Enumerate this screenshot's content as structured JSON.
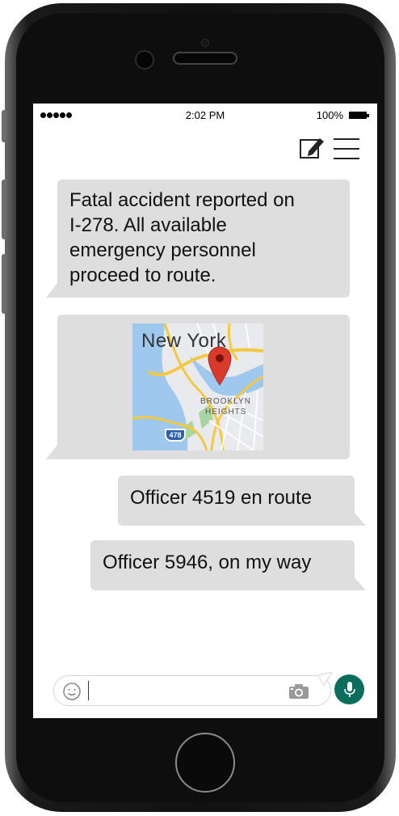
{
  "status_bar": {
    "time": "2:02 PM",
    "battery": "100%"
  },
  "toolbar": {
    "compose_icon": "compose-icon",
    "menu_icon": "hamburger-menu-icon"
  },
  "messages": [
    {
      "direction": "incoming",
      "text": "Fatal accident reported on I-278. All available emergency personnel proceed to route.",
      "lines": [
        "Fatal accident reported on",
        "I-278. All available",
        "emergency personnel",
        "proceed to route."
      ]
    },
    {
      "direction": "incoming",
      "type": "map",
      "map": {
        "city_label": "New York",
        "area_label_line1": "BROOKLYN",
        "area_label_line2": "HEIGHTS",
        "route_shield": "478",
        "pin_icon": "map-pin-icon"
      }
    },
    {
      "direction": "outgoing",
      "text": "Officer 4519 en route"
    },
    {
      "direction": "outgoing",
      "text": "Officer 5946, on my way"
    }
  ],
  "input_bar": {
    "value": "",
    "emoji_icon": "emoji-icon",
    "camera_icon": "camera-icon",
    "mic_icon": "microphone-icon"
  },
  "colors": {
    "bubble": "#dedede",
    "mic_button": "#0b6e5c",
    "map_water": "#9fc8ef",
    "map_road": "#f5c842",
    "map_pin": "#d93a2b"
  }
}
